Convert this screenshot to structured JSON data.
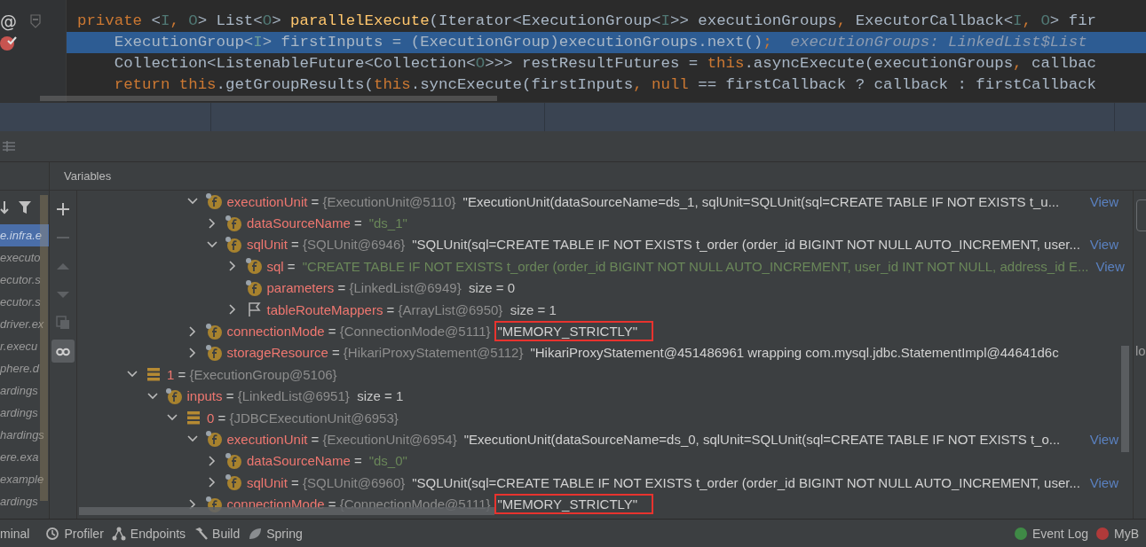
{
  "editor": {
    "lines": [
      {
        "gutter_mark": "@",
        "fold": true,
        "breakpoint": false,
        "current": false,
        "tokens": [
          {
            "text": "private ",
            "kind": "kw"
          },
          {
            "text": "<",
            "kind": "txt"
          },
          {
            "text": "I",
            "kind": "tp"
          },
          {
            "text": ", ",
            "kind": "kw"
          },
          {
            "text": "O",
            "kind": "tp"
          },
          {
            "text": "> List<",
            "kind": "txt"
          },
          {
            "text": "O",
            "kind": "tp"
          },
          {
            "text": "> ",
            "kind": "txt"
          },
          {
            "text": "parallelExecute",
            "kind": "fn"
          },
          {
            "text": "(Iterator<ExecutionGroup<",
            "kind": "txt"
          },
          {
            "text": "I",
            "kind": "tp"
          },
          {
            "text": ">> executionGroups",
            "kind": "txt"
          },
          {
            "text": ", ",
            "kind": "kw"
          },
          {
            "text": "ExecutorCallback<",
            "kind": "txt"
          },
          {
            "text": "I",
            "kind": "tp"
          },
          {
            "text": ", ",
            "kind": "kw"
          },
          {
            "text": "O",
            "kind": "tp"
          },
          {
            "text": "> fir",
            "kind": "txt"
          }
        ]
      },
      {
        "fold": false,
        "breakpoint": true,
        "current": true,
        "tokens": [
          {
            "text": "    ExecutionGroup<",
            "kind": "txt"
          },
          {
            "text": "I",
            "kind": "tp"
          },
          {
            "text": "> firstInputs = (ExecutionGroup)executionGroups.next()",
            "kind": "txt"
          },
          {
            "text": ";",
            "kind": "kw"
          },
          {
            "text": "  executionGroups: LinkedList$List",
            "kind": "hint"
          }
        ]
      },
      {
        "fold": false,
        "breakpoint": false,
        "current": false,
        "tokens": [
          {
            "text": "    Collection<ListenableFuture<Collection<",
            "kind": "txt"
          },
          {
            "text": "O",
            "kind": "tp"
          },
          {
            "text": ">>> restResultFutures = ",
            "kind": "txt"
          },
          {
            "text": "this",
            "kind": "kw"
          },
          {
            "text": ".asyncExecute(executionGroups",
            "kind": "txt"
          },
          {
            "text": ", ",
            "kind": "kw"
          },
          {
            "text": "callbac",
            "kind": "txt"
          }
        ]
      },
      {
        "fold": false,
        "breakpoint": false,
        "current": false,
        "tokens": [
          {
            "text": "    return this",
            "kind": "kw"
          },
          {
            "text": ".getGroupResults(",
            "kind": "txt"
          },
          {
            "text": "this",
            "kind": "kw"
          },
          {
            "text": ".syncExecute(firstInputs",
            "kind": "txt"
          },
          {
            "text": ", null ",
            "kind": "kw"
          },
          {
            "text": "== firstCallback ? callback : firstCallback",
            "kind": "txt"
          }
        ]
      }
    ]
  },
  "debugger": {
    "panel_title": "Variables",
    "frames": [
      {
        "label": "e.infra.e",
        "selected": true
      },
      {
        "label": "executo",
        "selected": false
      },
      {
        "label": "ecutor.s",
        "selected": false
      },
      {
        "label": "ecutor.s",
        "selected": false
      },
      {
        "label": "driver.ex",
        "selected": false
      },
      {
        "label": "r.execu",
        "selected": false
      },
      {
        "label": "phere.d",
        "selected": false
      },
      {
        "label": "ardings",
        "selected": false
      },
      {
        "label": "ardings",
        "selected": false
      },
      {
        "label": "hardings",
        "selected": false
      },
      {
        "label": "ere.exa",
        "selected": false
      },
      {
        "label": "example",
        "selected": false
      },
      {
        "label": "ardings",
        "selected": false
      }
    ],
    "tools": [
      {
        "kind": "add",
        "active": false
      },
      {
        "kind": "remove",
        "active": false
      },
      {
        "kind": "up",
        "active": false
      },
      {
        "kind": "down",
        "active": false
      },
      {
        "kind": "copy",
        "active": false
      },
      {
        "kind": "glasses",
        "active": true
      }
    ],
    "variables": [
      {
        "children": [
          {
            "children": [
              {
                "children": [
                  {
                    "name": "executionUnit",
                    "op": "=",
                    "type": "{ExecutionUnit@5110}",
                    "value": "\"ExecutionUnit(dataSourceName=ds_1, sqlUnit=SQLUnit(sql=CREATE TABLE IF NOT EXISTS t_u...",
                    "view": "View",
                    "kind": "field",
                    "expanded": true,
                    "children": [
                      {
                        "name": "dataSourceName",
                        "op": "=",
                        "value": "\"ds_1\"",
                        "kind": "literal",
                        "expanded": false
                      },
                      {
                        "name": "sqlUnit",
                        "op": "=",
                        "type": "{SQLUnit@6946}",
                        "value": "\"SQLUnit(sql=CREATE TABLE IF NOT EXISTS t_order (order_id BIGINT NOT NULL AUTO_INCREMENT, user...",
                        "view": "View",
                        "kind": "field",
                        "expanded": true,
                        "children": [
                          {
                            "name": "sql",
                            "op": "=",
                            "value": "\"CREATE TABLE IF NOT EXISTS t_order (order_id BIGINT NOT NULL AUTO_INCREMENT, user_id INT NOT NULL, address_id E...",
                            "view": "View",
                            "kind": "literal",
                            "expanded": false
                          },
                          {
                            "name": "parameters",
                            "op": "=",
                            "type": "{LinkedList@6949}",
                            "size": "size = 0",
                            "kind": "field"
                          },
                          {
                            "name": "tableRouteMappers",
                            "op": "=",
                            "type": "{ArrayList@6950}",
                            "size": "size = 1",
                            "kind": "flag",
                            "expanded": false
                          }
                        ]
                      }
                    ]
                  },
                  {
                    "name": "connectionMode",
                    "op": "=",
                    "type": "{ConnectionMode@5111}",
                    "value": "\"MEMORY_STRICTLY\"",
                    "kind": "field",
                    "expanded": false,
                    "highlighted": true
                  },
                  {
                    "name": "storageResource",
                    "op": "=",
                    "type": "{HikariProxyStatement@5112}",
                    "value": "\"HikariProxyStatement@451486961 wrapping com.mysql.jdbc.StatementImpl@44641d6c",
                    "kind": "field",
                    "expanded": false
                  }
                ]
              }
            ]
          }
        ]
      },
      {
        "name": "1",
        "op": "=",
        "type": "{ExecutionGroup@5106}",
        "kind": "element",
        "expanded": true,
        "children": [
          {
            "name": "inputs",
            "op": "=",
            "type": "{LinkedList@6951}",
            "size": "size = 1",
            "kind": "field",
            "expanded": true,
            "children": [
              {
                "name": "0",
                "op": "=",
                "type": "{JDBCExecutionUnit@6953}",
                "kind": "element",
                "expanded": true,
                "children": [
                  {
                    "name": "executionUnit",
                    "op": "=",
                    "type": "{ExecutionUnit@6954}",
                    "value": "\"ExecutionUnit(dataSourceName=ds_0, sqlUnit=SQLUnit(sql=CREATE TABLE IF NOT EXISTS t_o...",
                    "view": "View",
                    "kind": "field",
                    "expanded": true,
                    "children": [
                      {
                        "name": "dataSourceName",
                        "op": "=",
                        "value": "\"ds_0\"",
                        "kind": "literal",
                        "expanded": false
                      },
                      {
                        "name": "sqlUnit",
                        "op": "=",
                        "type": "{SQLUnit@6960}",
                        "value": "\"SQLUnit(sql=CREATE TABLE IF NOT EXISTS t_order (order_id BIGINT NOT NULL AUTO_INCREMENT, user...",
                        "view": "View",
                        "kind": "field",
                        "expanded": false
                      }
                    ]
                  },
                  {
                    "name": "connectionMode",
                    "op": "=",
                    "type": "{ConnectionMode@5111}",
                    "value": "\"MEMORY_STRICTLY\"",
                    "kind": "field",
                    "expanded": false,
                    "highlighted": true
                  }
                ]
              }
            ]
          }
        ]
      }
    ]
  },
  "side_label": "lo",
  "tool_windows": [
    {
      "label": "minal",
      "kind": "none"
    },
    {
      "label": "Profiler",
      "kind": "profiler"
    },
    {
      "label": "Endpoints",
      "kind": "endpoints"
    },
    {
      "label": "Build",
      "kind": "build"
    },
    {
      "label": "Spring",
      "kind": "spring"
    }
  ],
  "status_items": [
    {
      "label": "Event Log",
      "kind": "event"
    },
    {
      "label": "MyB",
      "kind": "mybatis"
    }
  ]
}
